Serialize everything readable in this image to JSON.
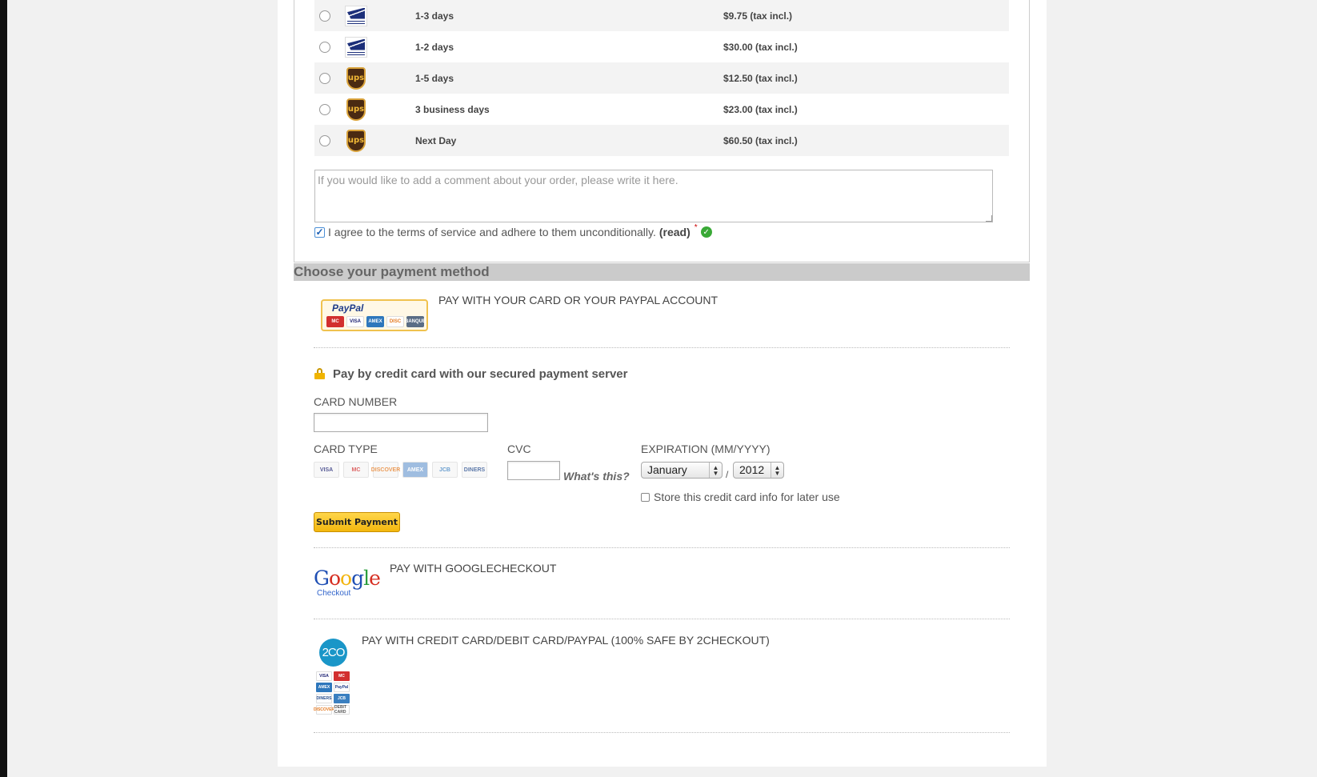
{
  "carriers": [
    {
      "logo": "usps-icon",
      "delay": "1-3 days",
      "price": "$9.75 (tax incl.)"
    },
    {
      "logo": "usps-icon",
      "delay": "1-2 days",
      "price": "$30.00 (tax incl.)"
    },
    {
      "logo": "ups-icon",
      "delay": "1-5 days",
      "price": "$12.50 (tax incl.)"
    },
    {
      "logo": "ups-icon",
      "delay": "3 business days",
      "price": "$23.00 (tax incl.)"
    },
    {
      "logo": "ups-icon",
      "delay": "Next Day",
      "price": "$60.50 (tax incl.)"
    }
  ],
  "comment": {
    "placeholder": "If you would like to add a comment about your order, please write it here."
  },
  "terms": {
    "text": "I agree to the terms of service and adhere to them unconditionally.",
    "read_link": "(read)",
    "required_mark": "*",
    "checked": true
  },
  "payment": {
    "section_title": "Choose your payment method",
    "paypal": {
      "badge_text": "PayPal",
      "badge_cards": [
        "MC",
        "VISA",
        "AMEX",
        "DISC",
        "BANQUE"
      ],
      "label": "PAY WITH YOUR CARD OR YOUR PAYPAL ACCOUNT"
    },
    "credit_card": {
      "title": "Pay by credit card with our secured payment server",
      "card_number_label": "CARD NUMBER",
      "card_type_label": "CARD TYPE",
      "card_types": [
        "VISA",
        "MC",
        "DISCOVER",
        "AMEX",
        "JCB",
        "DINERS"
      ],
      "cvc_label": "CVC",
      "whats_this": "What's this?",
      "expiration_label": "EXPIRATION (MM/YYYY)",
      "month": "January",
      "year": "2012",
      "separator": "/",
      "store_label": "Store this credit card info for later use",
      "submit_label": "Submit Payment"
    },
    "google": {
      "logo_text": "Google",
      "logo_sub": "Checkout",
      "label": "PAY WITH GOOGLECHECKOUT"
    },
    "twocheckout": {
      "logo_text": "2CO",
      "cards": [
        "VISA",
        "MC",
        "AMEX",
        "PayPal",
        "DINERS",
        "JCB",
        "DISCOVER",
        "DEBIT CARD"
      ],
      "label": "PAY WITH CREDIT CARD/DEBIT CARD/PAYPAL (100% SAFE BY 2CHECKOUT)"
    }
  },
  "colors": {
    "page_bg": "#f1f1f1",
    "section_bar": "#cbcbcb",
    "submit_button": "#f3b70e",
    "ok_icon": "#39a936",
    "usps_blue": "#1c2f7a",
    "ups_brown": "#4a2a12"
  }
}
